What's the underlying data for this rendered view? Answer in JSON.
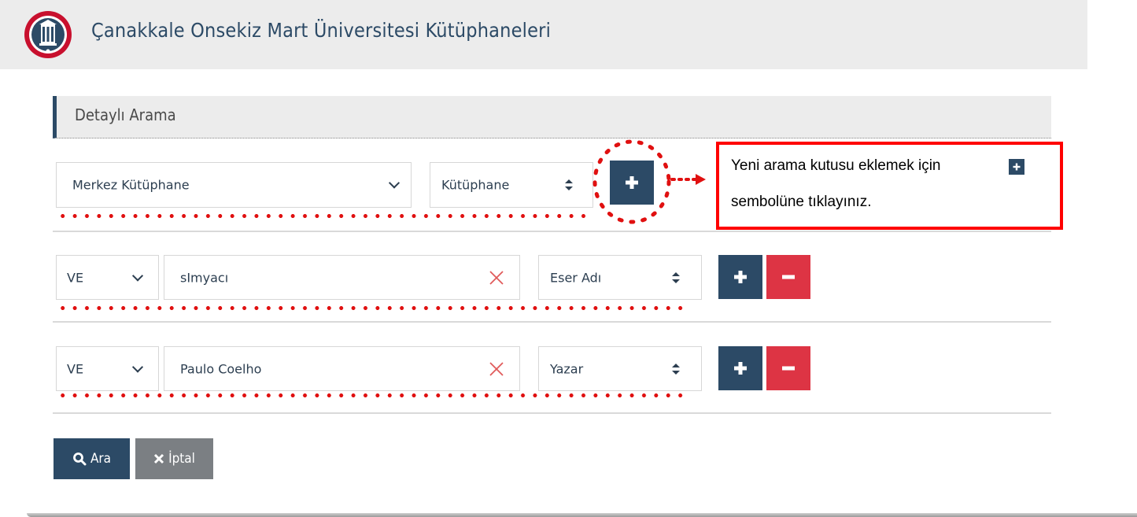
{
  "header": {
    "title": "Çanakkale Onsekiz Mart Üniversitesi Kütüphaneleri"
  },
  "section": {
    "title": "Detaylı Arama"
  },
  "library_row": {
    "library_select": "Merkez Kütüphane",
    "filter_select": "Kütüphane"
  },
  "search_rows": [
    {
      "operator": "VE",
      "term": "sImyacı",
      "field": "Eser Adı"
    },
    {
      "operator": "VE",
      "term": "Paulo Coelho",
      "field": "Yazar"
    }
  ],
  "callout": {
    "line1": "Yeni arama kutusu eklemek için",
    "line2": "sembolüne tıklayınız.",
    "border_color": "#ff0000"
  },
  "actions": {
    "search_label": "Ara",
    "cancel_label": "İptal"
  },
  "colors": {
    "primary": "#2c4a66",
    "danger": "#dd3444",
    "annotation": "#e01010",
    "cancel": "#7b7f83"
  }
}
